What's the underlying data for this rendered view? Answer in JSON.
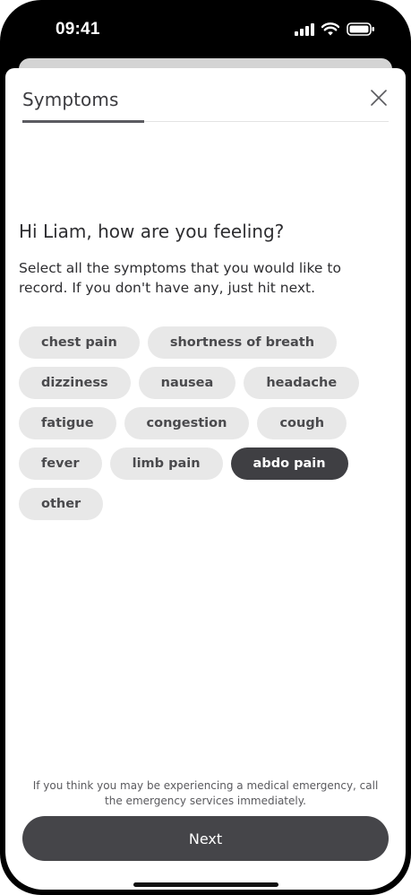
{
  "status_bar": {
    "time": "09:41"
  },
  "header": {
    "title": "Symptoms"
  },
  "content": {
    "heading": "Hi Liam, how are you feeling?",
    "subtext": "Select all the symptoms that you would like to record. If you don't have any, just hit next."
  },
  "symptoms": [
    {
      "label": "chest pain",
      "selected": false
    },
    {
      "label": "shortness of breath",
      "selected": false
    },
    {
      "label": "dizziness",
      "selected": false
    },
    {
      "label": "nausea",
      "selected": false
    },
    {
      "label": "headache",
      "selected": false
    },
    {
      "label": "fatigue",
      "selected": false
    },
    {
      "label": "congestion",
      "selected": false
    },
    {
      "label": "cough",
      "selected": false
    },
    {
      "label": "fever",
      "selected": false
    },
    {
      "label": "limb pain",
      "selected": false
    },
    {
      "label": "abdo pain",
      "selected": true
    },
    {
      "label": "other",
      "selected": false
    }
  ],
  "footer": {
    "disclaimer": "If you think you may be experiencing a medical emergency, call the emergency services immediately.",
    "next_label": "Next"
  },
  "icons": {
    "close": "close-icon",
    "signal": "signal-icon",
    "wifi": "wifi-icon",
    "battery": "battery-icon"
  },
  "colors": {
    "chip_background": "#e8e8e8",
    "chip_selected_background": "#3f3f43",
    "button_background": "#454549"
  }
}
